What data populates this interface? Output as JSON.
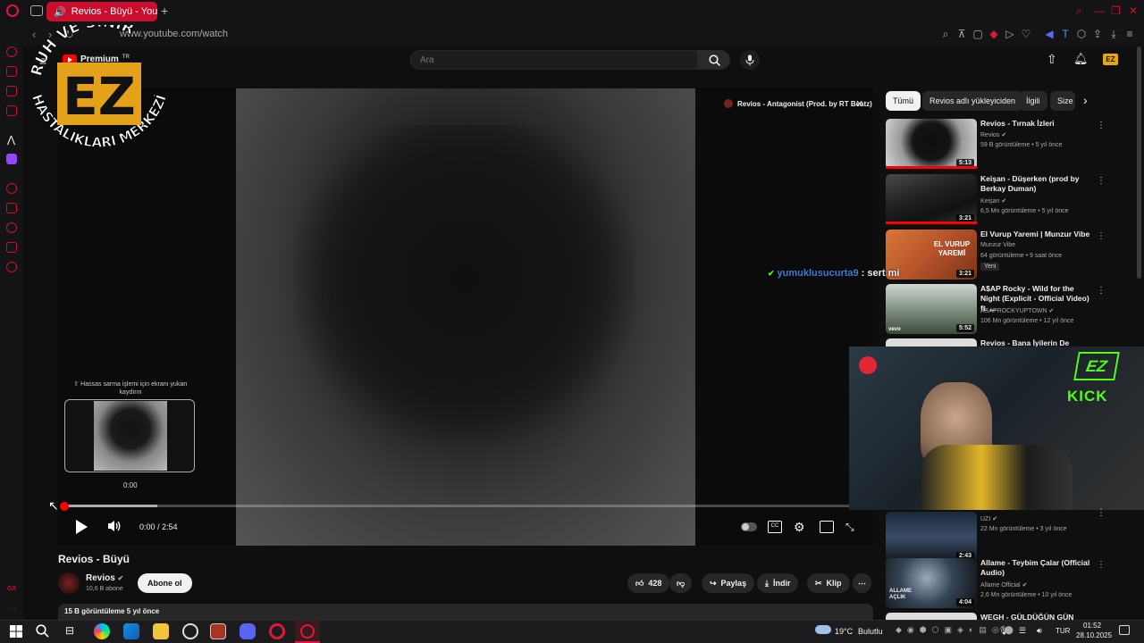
{
  "browser": {
    "tab_title": "Revios - Büyü - YouTu",
    "url": "www.youtube.com/watch"
  },
  "youtube": {
    "logo_label": "Premium",
    "logo_region": "TR",
    "search_placeholder": "Ara"
  },
  "overlay": {
    "arc_top": "RUH VE SİNİR",
    "arc_bottom": "HASTALIKLARI MERKEZİ",
    "monogram": "EZ"
  },
  "player": {
    "title_card": "Revios - Antagonist (Prod. by RT Beatz)",
    "preview_hint": "⇧ Hassas sarma işlemi için ekranı yukarı kaydırın",
    "preview_time": "0:00",
    "time_current": "0:00",
    "time_total": "2:54",
    "progress_fraction": 0.0,
    "buffer_fraction": 0.118
  },
  "video": {
    "title": "Revios - Büyü",
    "channel": "Revios",
    "subscribers": "10,6 B abone",
    "subscribe_label": "Abone ol",
    "likes": "428",
    "share_label": "Paylaş",
    "download_label": "İndir",
    "clip_label": "Klip",
    "views_date": "15 B görüntüleme  5 yıl önce"
  },
  "chips": [
    "Tümü",
    "Revios adlı yükleyiciden",
    "İlgili",
    "Size"
  ],
  "recommendations": [
    {
      "title": "Revios - Tırnak İzleri",
      "channel": "Revios",
      "meta": "59 B görüntüleme • 5 yıl önce",
      "duration": "5:13",
      "badge": ""
    },
    {
      "title": "Keişan - Düşerken (prod by Berkay Duman)",
      "channel": "Keişan",
      "meta": "6,5 Mn görüntüleme • 5 yıl önce",
      "duration": "3:21",
      "badge": ""
    },
    {
      "title": "El Vurup Yaremi | Munzur Vibe",
      "channel": "Munzur Vibe",
      "meta": "64 görüntüleme • 9 saat önce",
      "duration": "3:21",
      "badge": "Yeni",
      "thumb_text": "EL VURUP YAREMİ"
    },
    {
      "title": "A$AP Rocky - Wild for the Night (Explicit - Official Video) ft. ...",
      "channel": "ASAPROCKYUPTOWN",
      "meta": "106 Mn görüntüleme • 12 yıl önce",
      "duration": "5:52",
      "badge": ""
    },
    {
      "title": "Revios - Bana İyilerin De",
      "channel": "",
      "meta": "",
      "duration": "",
      "badge": ""
    },
    {
      "title": "",
      "channel": "UZI",
      "meta": "22 Mn görüntüleme • 3 yıl önce",
      "duration": "2:43",
      "badge": ""
    },
    {
      "title": "Allame - Teybim Çalar (Official Audio)",
      "channel": "Allame Official",
      "meta": "2,6 Mn görüntüleme • 10 yıl önce",
      "duration": "4:04",
      "badge": "",
      "thumb_text": "ALLAME AÇLIK"
    },
    {
      "title": "WEGH - GÜLDÜĞÜN GÜN",
      "channel": "",
      "meta": "",
      "duration": "",
      "badge": ""
    }
  ],
  "stream": {
    "chat_user": "yumuklusucurta9",
    "chat_text": ": sert mi",
    "kick_label": "KICK",
    "kick_monogram": "EZ"
  },
  "taskbar": {
    "weather_temp": "19°C",
    "weather_desc": "Bulutlu",
    "lang": "TUR",
    "time": "01:52",
    "date": "28.10.2025"
  },
  "colors": {
    "accent": "#c8102e",
    "yt_red": "#ff0000",
    "chat_user": "#3b7dd8",
    "kick_green": "#53fc18"
  }
}
